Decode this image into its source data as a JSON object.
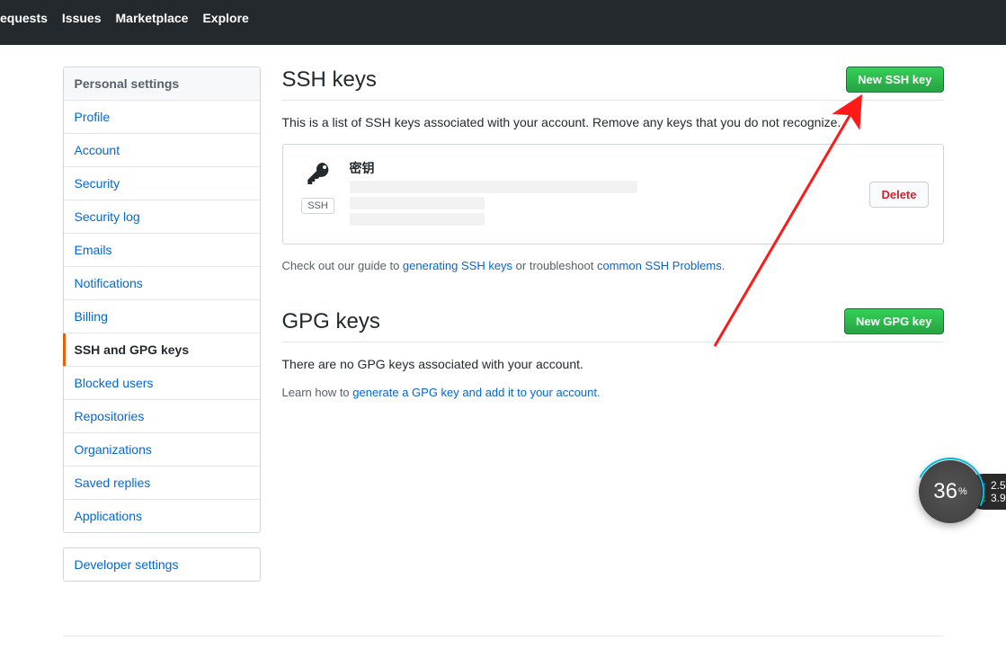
{
  "header": {
    "nav": [
      {
        "label": "equests"
      },
      {
        "label": "Issues"
      },
      {
        "label": "Marketplace"
      },
      {
        "label": "Explore"
      }
    ]
  },
  "sidebar": {
    "heading": "Personal settings",
    "items": [
      {
        "label": "Profile"
      },
      {
        "label": "Account"
      },
      {
        "label": "Security"
      },
      {
        "label": "Security log"
      },
      {
        "label": "Emails"
      },
      {
        "label": "Notifications"
      },
      {
        "label": "Billing"
      },
      {
        "label": "SSH and GPG keys",
        "selected": true
      },
      {
        "label": "Blocked users"
      },
      {
        "label": "Repositories"
      },
      {
        "label": "Organizations"
      },
      {
        "label": "Saved replies"
      },
      {
        "label": "Applications"
      }
    ],
    "secondary": {
      "items": [
        {
          "label": "Developer settings"
        }
      ]
    }
  },
  "ssh": {
    "title": "SSH keys",
    "new_btn": "New SSH key",
    "description": "This is a list of SSH keys associated with your account. Remove any keys that you do not recognize.",
    "key": {
      "name": "密钥",
      "type_badge": "SSH",
      "delete_btn": "Delete"
    },
    "guide_prefix": "Check out our guide to ",
    "guide_link1": "generating SSH keys",
    "guide_mid": " or troubleshoot ",
    "guide_link2": "common SSH Problems",
    "guide_suffix": "."
  },
  "gpg": {
    "title": "GPG keys",
    "new_btn": "New GPG key",
    "empty": "There are no GPG keys associated with your account.",
    "learn_prefix": "Learn how to ",
    "learn_link": "generate a GPG key and add it to your account",
    "learn_suffix": "."
  },
  "widget": {
    "percent": "36",
    "pct_symbol": "%",
    "up": "2.5",
    "down": "3.9"
  }
}
